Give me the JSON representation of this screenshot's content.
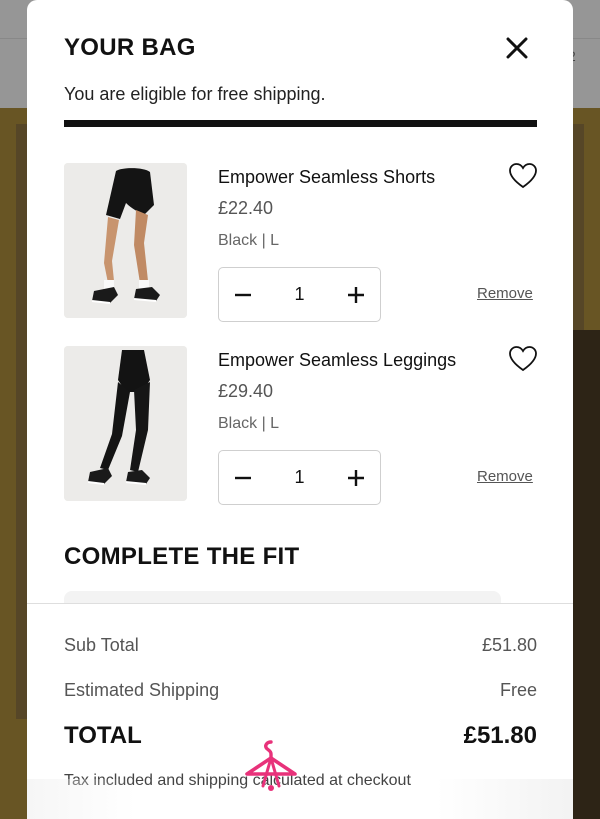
{
  "background": {
    "corner_text": "2"
  },
  "bag": {
    "title": "YOUR BAG",
    "shipping_message": "You are eligible for free shipping.",
    "free_shipping_progress": 1.0,
    "close_icon": "close-icon"
  },
  "items": [
    {
      "name": "Empower Seamless Shorts",
      "price": "£22.40",
      "variant": "Black | L",
      "quantity": "1",
      "remove_label": "Remove",
      "image": "black-seamless-shorts-product-photo"
    },
    {
      "name": "Empower Seamless Leggings",
      "price": "£29.40",
      "variant": "Black | L",
      "quantity": "1",
      "remove_label": "Remove",
      "image": "black-seamless-leggings-product-photo"
    }
  ],
  "complete_the_fit": {
    "title": "COMPLETE THE FIT"
  },
  "summary": {
    "subtotal_label": "Sub Total",
    "subtotal_value": "£51.80",
    "shipping_label": "Estimated Shipping",
    "shipping_value": "Free",
    "total_label": "TOTAL",
    "total_value": "£51.80",
    "tax_note": "Tax included and shipping calculated at checkout"
  },
  "colors": {
    "accent": "#111111",
    "watermark": "#e8327a"
  }
}
